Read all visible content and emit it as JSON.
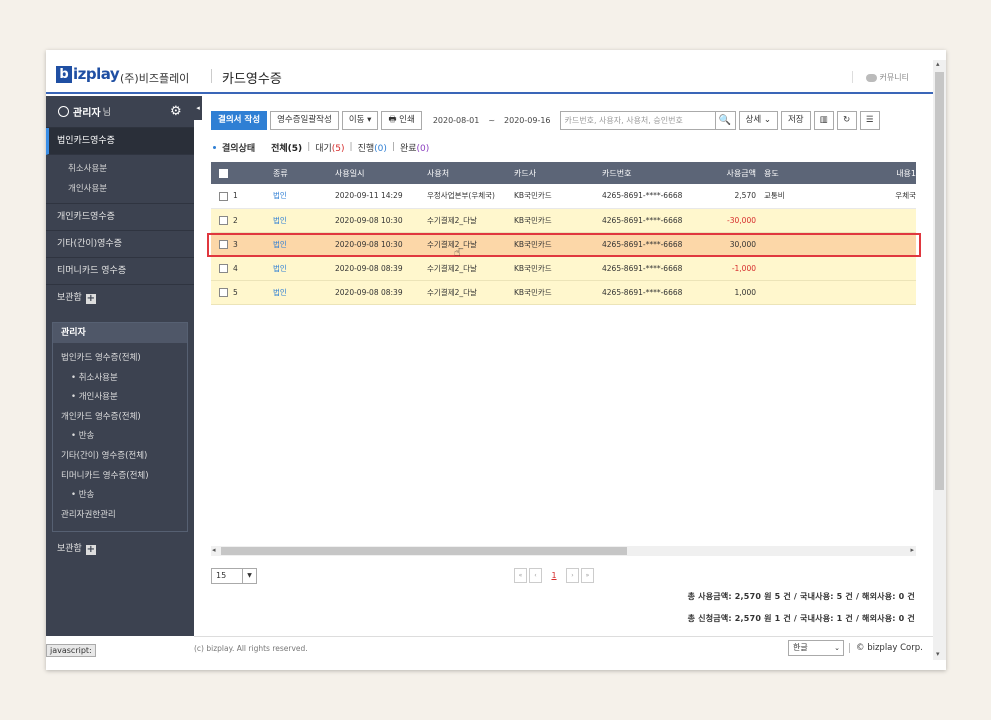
{
  "header": {
    "logo_letter": "b",
    "logo_text": "izplay",
    "company": "(주)비즈플레이",
    "page_title": "카드영수증",
    "community": "커뮤니티"
  },
  "sidebar": {
    "admin_name": "관리자",
    "admin_suffix": "님",
    "items": [
      {
        "label": "법인카드영수증"
      },
      {
        "label": "개인카드영수증"
      },
      {
        "label": "기타(간이)영수증"
      },
      {
        "label": "티머니카드 영수증"
      }
    ],
    "sub_items": [
      "취소사용분",
      "개인사용분"
    ],
    "storage": "보관함",
    "admin_panel": {
      "title": "관리자",
      "items": [
        "법인카드 영수증(전체)",
        "• 취소사용분",
        "• 개인사용분",
        "개인카드 영수증(전체)",
        "• 반송",
        "기타(간이) 영수증(전체)",
        "티머니카드 영수증(전체)",
        "• 반송",
        "관리자권한관리"
      ]
    },
    "storage2": "보관함"
  },
  "toolbar": {
    "write_btn": "결의서 작성",
    "batch_btn": "영수증일괄작성",
    "move_btn": "이동",
    "print_btn": "인쇄",
    "date_from": "2020-08-01",
    "tilde": "~",
    "date_to": "2020-09-16",
    "search_placeholder": "카드번호, 사용자, 사용처, 승인번호",
    "detail_btn": "상세",
    "save_btn": "저장"
  },
  "status": {
    "label": "결의상태",
    "all": "전체(5)",
    "waiting_label": "대기",
    "waiting_count": "(5)",
    "progress_label": "진행",
    "progress_count": "(0)",
    "done_label": "완료",
    "done_count": "(0)"
  },
  "table": {
    "headers": [
      "종류",
      "사용일시",
      "사용처",
      "카드사",
      "카드번호",
      "사용금액",
      "용도",
      "내용1"
    ],
    "rows": [
      {
        "no": "1",
        "type": "법인",
        "datetime": "2020-09-11 14:29",
        "place": "우정사업본부(우체국)",
        "card_co": "KB국민카드",
        "card_no": "4265-8691-****-6668",
        "amount": "2,570",
        "purpose": "교통비",
        "memo": "우체국"
      },
      {
        "no": "2",
        "type": "법인",
        "datetime": "2020-09-08 10:30",
        "place": "수기결제2_다날",
        "card_co": "KB국민카드",
        "card_no": "4265-8691-****-6668",
        "amount": "-30,000",
        "purpose": "",
        "memo": ""
      },
      {
        "no": "3",
        "type": "법인",
        "datetime": "2020-09-08 10:30",
        "place": "수기결제2_다날",
        "card_co": "KB국민카드",
        "card_no": "4265-8691-****-6668",
        "amount": "30,000",
        "purpose": "",
        "memo": ""
      },
      {
        "no": "4",
        "type": "법인",
        "datetime": "2020-09-08 08:39",
        "place": "수기결제2_다날",
        "card_co": "KB국민카드",
        "card_no": "4265-8691-****-6668",
        "amount": "-1,000",
        "purpose": "",
        "memo": ""
      },
      {
        "no": "5",
        "type": "법인",
        "datetime": "2020-09-08 08:39",
        "place": "수기결제2_다날",
        "card_co": "KB국민카드",
        "card_no": "4265-8691-****-6668",
        "amount": "1,000",
        "purpose": "",
        "memo": ""
      }
    ]
  },
  "pager": {
    "page_size": "15",
    "current_page": "1"
  },
  "totals": {
    "line1": "총 사용금액: 2,570 원 5 건 / 국내사용: 5 건 / 해외사용: 0 건",
    "line2": "총 신청금액: 2,570 원 1 건 / 국내사용: 1 건 / 해외사용: 0 건"
  },
  "footer": {
    "copyright": "(c) bizplay. All rights reserved.",
    "language": "한글",
    "brand": "© bizplay Corp.",
    "status_tip": "javascript:"
  }
}
